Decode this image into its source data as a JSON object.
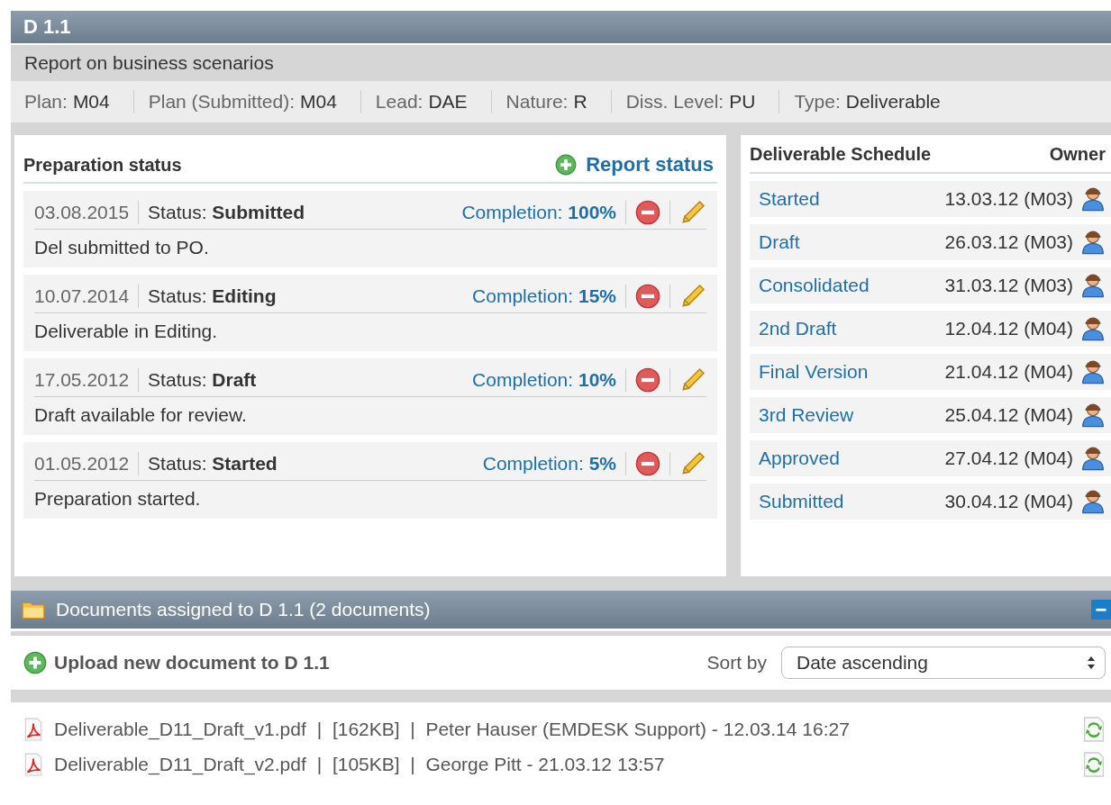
{
  "header": {
    "title": "D 1.1",
    "subtitle": "Report on business scenarios"
  },
  "meta": [
    {
      "label": "Plan:",
      "value": "M04"
    },
    {
      "label": "Plan (Submitted):",
      "value": "M04"
    },
    {
      "label": "Lead:",
      "value": "DAE"
    },
    {
      "label": "Nature:",
      "value": "R"
    },
    {
      "label": "Diss. Level:",
      "value": "PU"
    },
    {
      "label": "Type:",
      "value": "Deliverable"
    }
  ],
  "preparation": {
    "title": "Preparation status",
    "action": "Report status",
    "entries": [
      {
        "date": "03.08.2015",
        "status": "Status: **Submitted**",
        "completion": "Completion: **100%**",
        "note": "Del submitted to PO."
      },
      {
        "date": "10.07.2014",
        "status": "Status: **Editing**",
        "completion": "Completion: **15%**",
        "note": "Deliverable in Editing."
      },
      {
        "date": "17.05.2012",
        "status": "Status: **Draft**",
        "completion": "Completion: **10%**",
        "note": "Draft available for review."
      },
      {
        "date": "01.05.2012",
        "status": "Status: **Started**",
        "completion": "Completion: **5%**",
        "note": "Preparation started."
      }
    ]
  },
  "schedule": {
    "title": "Deliverable Schedule",
    "owner_header": "Owner",
    "rows": [
      {
        "milestone": "Started",
        "date": "13.03.12 (M03)"
      },
      {
        "milestone": "Draft",
        "date": "26.03.12 (M03)"
      },
      {
        "milestone": "Consolidated",
        "date": "31.03.12 (M03)"
      },
      {
        "milestone": "2nd Draft",
        "date": "12.04.12 (M04)"
      },
      {
        "milestone": "Final Version",
        "date": "21.04.12 (M04)"
      },
      {
        "milestone": "3rd Review",
        "date": "25.04.12 (M04)"
      },
      {
        "milestone": "Approved",
        "date": "27.04.12 (M04)"
      },
      {
        "milestone": "Submitted",
        "date": "30.04.12 (M04)"
      }
    ]
  },
  "documents": {
    "title": "Documents assigned to D 1.1 (2 documents)",
    "upload": "Upload new document to D 1.1",
    "sort_label": "Sort by",
    "sort_value": "Date ascending",
    "files": [
      {
        "name": "Deliverable_D11_Draft_v1.pdf",
        "details": "|  [162KB]  |  Peter Hauser (EMDESK Support) - 12.03.14 16:27"
      },
      {
        "name": "Deliverable_D11_Draft_v2.pdf",
        "details": "|  [105KB]  |  George Pitt - 21.03.12 13:57"
      }
    ]
  }
}
